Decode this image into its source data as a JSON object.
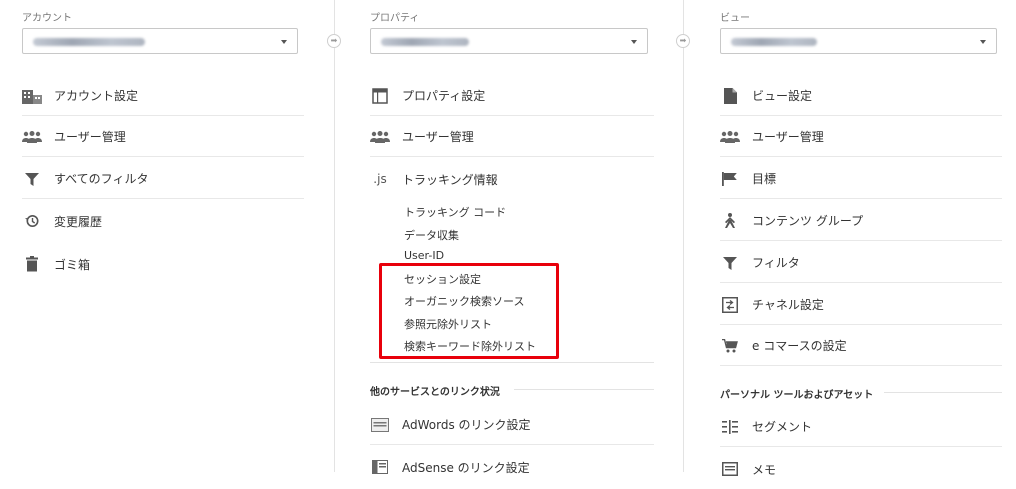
{
  "account": {
    "label": "アカウント",
    "selected_value": "",
    "items": [
      "アカウント設定",
      "ユーザー管理",
      "すべてのフィルタ",
      "変更履歴",
      "ゴミ箱"
    ]
  },
  "property": {
    "label": "プロパティ",
    "selected_value": "",
    "items": [
      "プロパティ設定",
      "ユーザー管理",
      "トラッキング情報"
    ],
    "tracking_prefix": ".js",
    "tracking_subitems": [
      "トラッキング コード",
      "データ収集",
      "User-ID",
      "セッション設定",
      "オーガニック検索ソース",
      "参照元除外リスト",
      "検索キーワード除外リスト"
    ],
    "linking_section_title": "他のサービスとのリンク状況",
    "linking_items": [
      "AdWords のリンク設定",
      "AdSense のリンク設定"
    ]
  },
  "view": {
    "label": "ビュー",
    "selected_value": "",
    "items": [
      "ビュー設定",
      "ユーザー管理",
      "目標",
      "コンテンツ グループ",
      "フィルタ",
      "チャネル設定",
      "e コマースの設定"
    ],
    "personal_section_title": "パーソナル ツールおよびアセット",
    "personal_items": [
      "セグメント",
      "メモ"
    ]
  },
  "highlight_color": "#e8000b",
  "icons": {
    "account_settings": "building-icon",
    "user_management": "users-icon",
    "filters": "funnel-icon",
    "history": "history-icon",
    "trash": "trash-icon",
    "property_settings": "window-icon",
    "view_settings": "document-icon",
    "goals": "flag-icon",
    "content_grouping": "person-walk-icon",
    "channel_settings": "channel-icon",
    "ecommerce": "cart-icon",
    "segment": "segment-icon",
    "memo": "note-icon",
    "adwords": "adwords-icon",
    "adsense": "adsense-icon"
  }
}
